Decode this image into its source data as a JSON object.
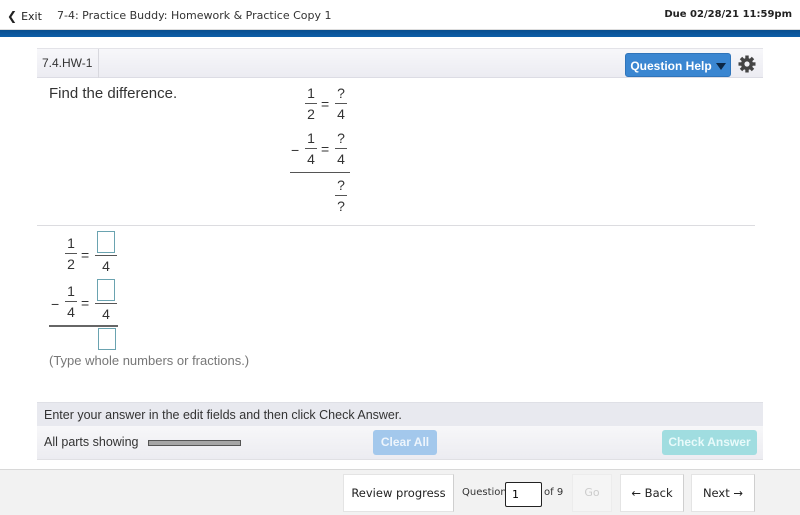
{
  "topbar": {
    "exit_label": "Exit",
    "title": "7-4: Practice Buddy: Homework & Practice Copy 1",
    "due": "Due 02/28/21 11:59pm"
  },
  "question": {
    "id": "7.4.HW-1",
    "help_label": "Question Help",
    "prompt": "Find the difference.",
    "example": {
      "row1": {
        "left_num": "1",
        "left_den": "2",
        "eq": "=",
        "right_num": "?",
        "right_den": "4"
      },
      "row2": {
        "sign": "−",
        "left_num": "1",
        "left_den": "4",
        "eq": "=",
        "right_num": "?",
        "right_den": "4"
      },
      "result": {
        "num": "?",
        "den": "?"
      }
    },
    "answer": {
      "row1": {
        "left_num": "1",
        "left_den": "2",
        "eq": "=",
        "right_num_value": "",
        "right_den": "4"
      },
      "row2": {
        "sign": "−",
        "left_num": "1",
        "left_den": "4",
        "eq": "=",
        "right_num_value": "",
        "right_den": "4"
      },
      "result_value": ""
    },
    "hint": "(Type whole numbers or fractions.)"
  },
  "instructions": "Enter your answer in the edit fields and then click Check Answer.",
  "actions": {
    "parts_label": "All parts showing",
    "clear_all": "Clear All",
    "check_answer": "Check Answer"
  },
  "footer": {
    "review_progress": "Review progress",
    "question_label": "Question",
    "question_number": "1",
    "of_label": "of 9",
    "go_label": "Go",
    "back_label": "← Back",
    "next_label": "Next →"
  },
  "colors": {
    "brand_bar": "#0d5ea8",
    "help_button": "#3a86d1",
    "clear_all_disabled": "#a3c8ec",
    "check_answer_disabled": "#a0dde0"
  }
}
